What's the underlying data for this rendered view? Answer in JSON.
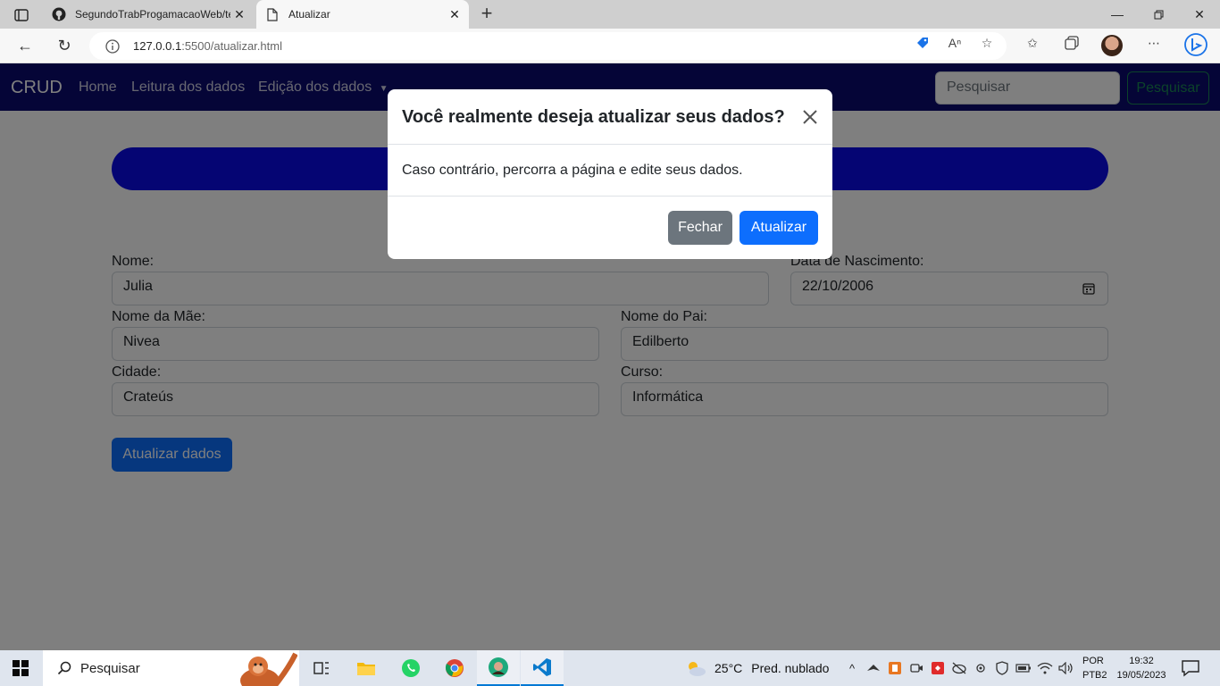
{
  "browser": {
    "tabs": [
      {
        "title": "SegundoTrabProgamacaoWeb/te",
        "icon": "github-icon",
        "active": false
      },
      {
        "title": "Atualizar",
        "icon": "page-icon",
        "active": true
      }
    ],
    "url": {
      "host": "127.0.0.1",
      "rest": ":5500/atualizar.html"
    }
  },
  "app": {
    "brand": "CRUD",
    "nav": {
      "home": "Home",
      "leitura": "Leitura dos dados",
      "edicao": "Edição dos dados"
    },
    "search": {
      "placeholder": "Pesquisar",
      "button": "Pesquisar"
    }
  },
  "form": {
    "nome": {
      "label": "Nome:",
      "value": "Julia"
    },
    "nascimento": {
      "label": "Data de Nascimento:",
      "value": "22/10/2006"
    },
    "mae": {
      "label": "Nome da Mãe:",
      "value": "Nivea"
    },
    "pai": {
      "label": "Nome do Pai:",
      "value": "Edilberto"
    },
    "cidade": {
      "label": "Cidade:",
      "value": "Crateús"
    },
    "curso": {
      "label": "Curso:",
      "value": "Informática"
    },
    "submit": "Atualizar dados"
  },
  "modal": {
    "title": "Você realmente deseja atualizar seus dados?",
    "body": "Caso contrário, percorra a página e edite seus dados.",
    "close_button": "Fechar",
    "confirm_button": "Atualizar"
  },
  "taskbar": {
    "search": "Pesquisar",
    "weather": {
      "temp": "25°C",
      "condition": "Pred. nublado"
    },
    "lang": {
      "line1": "POR",
      "line2": "PTB2"
    },
    "clock": {
      "time": "19:32",
      "date": "19/05/2023"
    }
  },
  "colors": {
    "navbar": "#0a0a6e",
    "pill": "#0a0ae6",
    "primary": "#0d6efd",
    "secondary": "#6c757d",
    "success": "#198754"
  }
}
